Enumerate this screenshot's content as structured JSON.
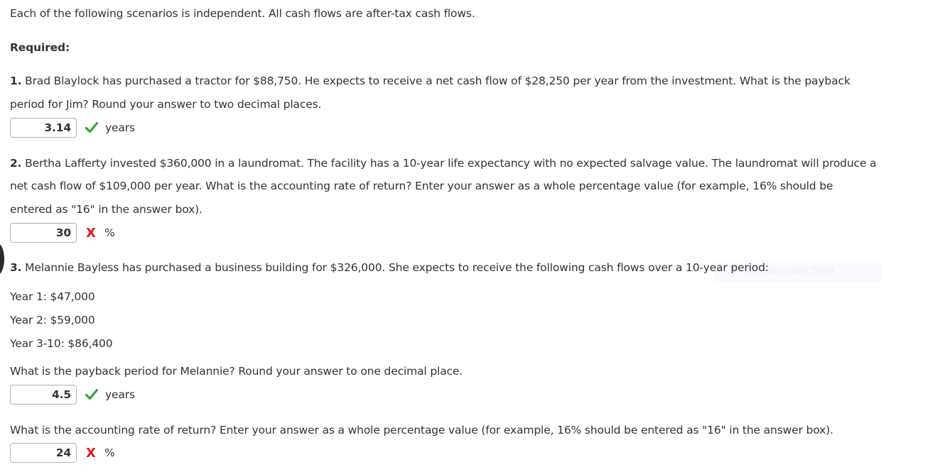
{
  "intro": "Each of the following scenarios is independent. All cash flows are after-tax cash flows.",
  "required_label": "Required:",
  "q1": {
    "number": "1.",
    "line1": " Brad Blaylock has purchased a tractor for $88,750. He expects to receive a net cash flow of $28,250 per year from the investment. What is the payback",
    "line2": "period for Jim? Round your answer to two decimal places.",
    "answer": "3.14",
    "status": "correct",
    "unit": "years"
  },
  "q2": {
    "number": "2.",
    "line1": " Bertha Lafferty invested $360,000 in a laundromat. The facility has a 10-year life expectancy with no expected salvage value. The laundromat will produce a",
    "line2": "net cash flow of $109,000 per year. What is the accounting rate of return? Enter your answer as a whole percentage value (for example, 16% should be",
    "line3": "entered as \"16\" in the answer box).",
    "answer": "30",
    "status": "incorrect",
    "unit": "%"
  },
  "q3": {
    "number": "3.",
    "line1": " Melannie Bayless has purchased a business building for $326,000. She expects to receive the following cash flows over a 10-year period:",
    "cash_flows": [
      "Year 1: $47,000",
      "Year 2: $59,000",
      "Year 3-10: $86,400"
    ],
    "part_a": {
      "question": "What is the payback period for Melannie? Round your answer to one decimal place.",
      "answer": "4.5",
      "status": "correct",
      "unit": "years"
    },
    "part_b": {
      "question": "What is the accounting rate of return? Enter your answer as a whole percentage value (for example, 16% should be entered as \"16\" in the answer box).",
      "answer": "24",
      "status": "incorrect",
      "unit": "%"
    }
  },
  "icons": {
    "correct": "checkmark-icon",
    "incorrect": "x-mark-icon",
    "incorrect_glyph": "X"
  },
  "ghost_tooltip": "Rectangular Snip",
  "colors": {
    "correct": "#3aa335",
    "incorrect": "#e8151d",
    "text": "#333333"
  }
}
